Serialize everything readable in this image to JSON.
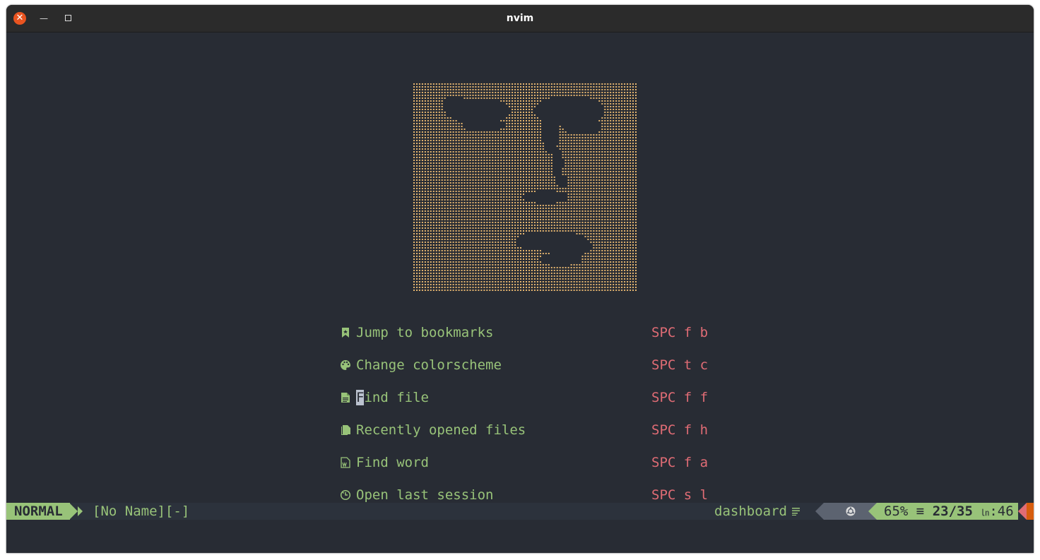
{
  "window": {
    "title": "nvim"
  },
  "colors": {
    "background": "#282c34",
    "menu_label": "#98c379",
    "menu_key": "#e06c75",
    "logo_dots": "#e5b56f",
    "mode_bg": "#98c379"
  },
  "dashboard": {
    "logo": "braille-art-face",
    "items": [
      {
        "icon": "bookmark-icon",
        "label_rest": "Jump to bookmarks",
        "key": "SPC f b"
      },
      {
        "icon": "palette-icon",
        "label_rest": "Change colorscheme",
        "key": "SPC t c"
      },
      {
        "icon": "file-icon",
        "cursor_char": "F",
        "label_rest": "ind file",
        "key": "SPC f f"
      },
      {
        "icon": "files-icon",
        "label_rest": "Recently opened files",
        "key": "SPC f h"
      },
      {
        "icon": "word-file-icon",
        "label_rest": "Find word",
        "key": "SPC f a"
      },
      {
        "icon": "session-icon",
        "label_rest": "Open last session",
        "key": "SPC s l"
      }
    ]
  },
  "statusline": {
    "mode": "NORMAL",
    "filename": "[No Name][-]",
    "filetype": "dashboard",
    "filetype_icon": "lines-icon",
    "os_icon": "ubuntu-icon",
    "percent": "65%",
    "lines_icon": "≡",
    "line_pos": "23/35",
    "col_icon": "㏑",
    "col": ":46"
  }
}
